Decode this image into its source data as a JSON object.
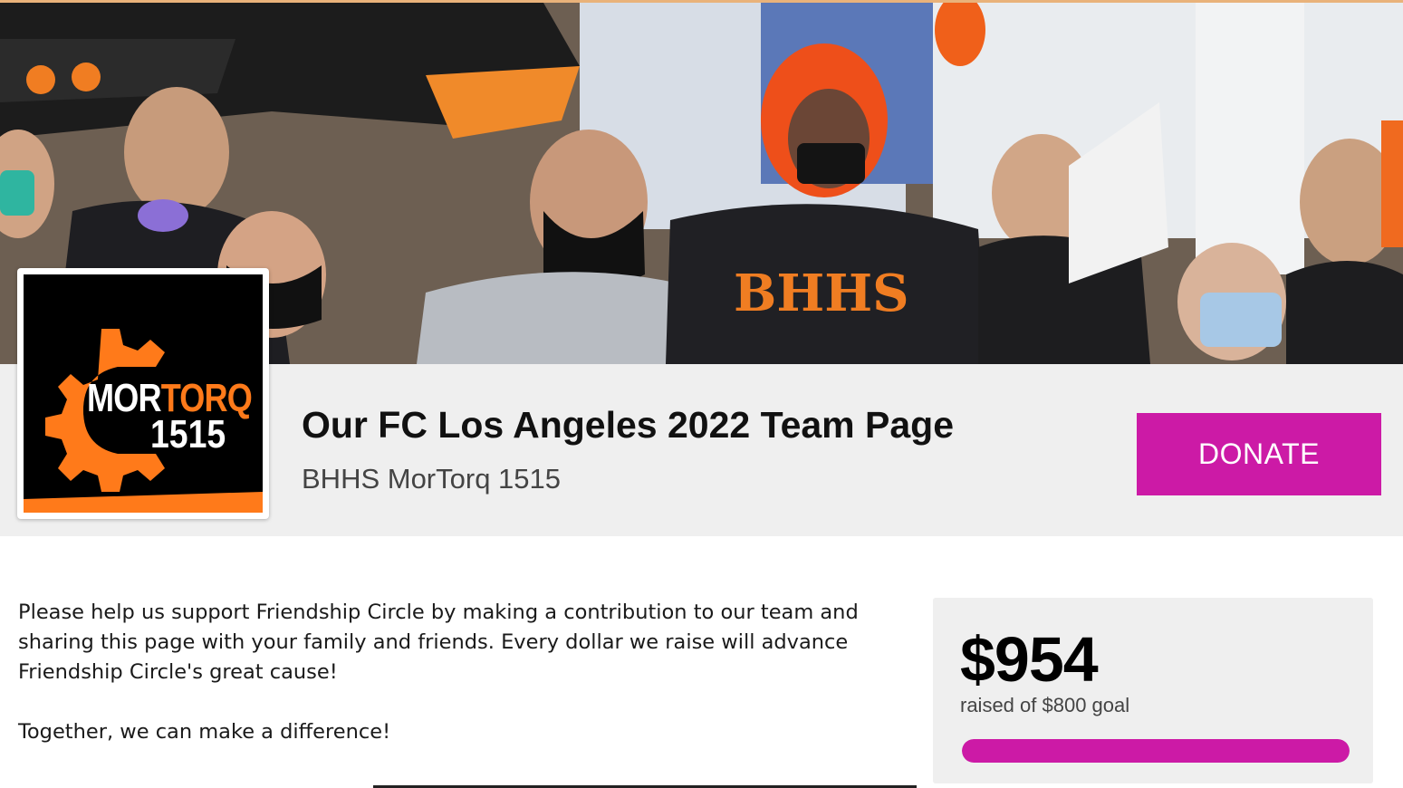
{
  "banner": {
    "image_name": "team-crowd-photo"
  },
  "logo": {
    "word_white": "MOR",
    "word_orange": "TORQ",
    "number": "1515",
    "accent_color": "#ff7a1a"
  },
  "header": {
    "title": "Our FC Los Angeles 2022 Team Page",
    "subtitle": "BHHS MorTorq 1515",
    "donate_label": "DONATE",
    "donate_color": "#cc1aa6"
  },
  "description": {
    "paragraph1": "Please help us support Friendship Circle by making a contribution to our team and sharing this page with your family and friends. Every dollar we raise will advance Friendship Circle's great cause!",
    "paragraph2": "Together, we can make a difference!"
  },
  "progress": {
    "amount": "$954",
    "goal_text": "raised of $800 goal",
    "fraction": 1.0,
    "bar_color": "#cc1aa6"
  }
}
